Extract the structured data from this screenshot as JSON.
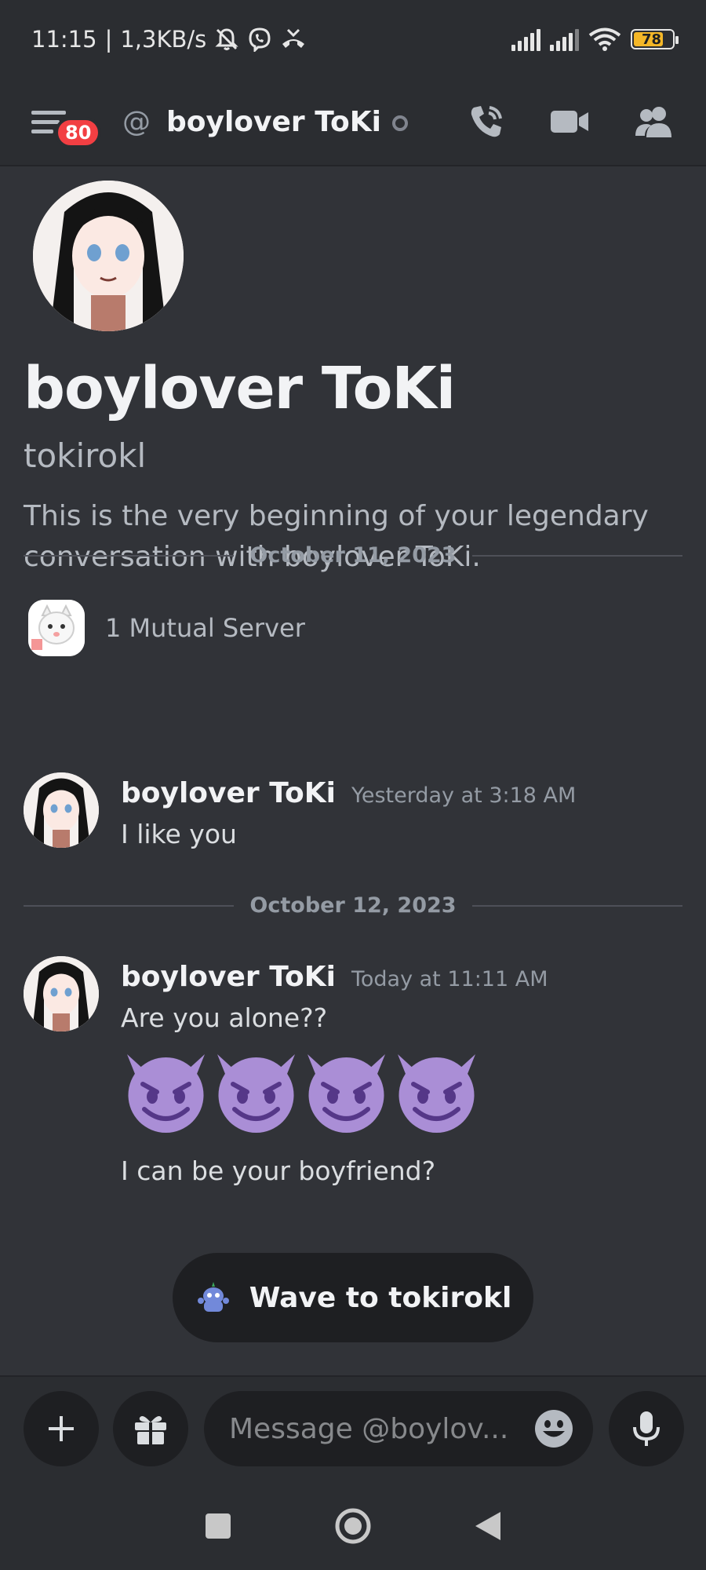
{
  "status_bar": {
    "time": "11:15",
    "net_speed": "1,3KB/s",
    "battery": "78",
    "battery_level": 0.78
  },
  "header": {
    "unread_badge": "80",
    "at_symbol": "@",
    "title": "boylover ToKi",
    "icons": [
      "menu-icon",
      "phone-call-icon",
      "video-camera-icon",
      "members-icon"
    ]
  },
  "profile": {
    "display_name": "boylover ToKi",
    "username": "tokirokl",
    "intro": "This is the very beginning of your legendary conversation with boylover ToKi.",
    "mutual_servers": "1 Mutual Server"
  },
  "messages": [
    {
      "date_divider": "October 11, 2023",
      "author": "boylover ToKi",
      "timestamp": "Yesterday at 3:18 AM",
      "lines": [
        "I like you"
      ]
    },
    {
      "date_divider": "October 12, 2023",
      "author": "boylover ToKi",
      "timestamp": "Today at 11:11 AM",
      "lines": [
        "Are you alone??",
        "I can be your boyfriend?"
      ],
      "emojis": [
        "smiling-imp-emoji",
        "smiling-imp-emoji",
        "smiling-imp-emoji",
        "smiling-imp-emoji"
      ]
    }
  ],
  "wave": {
    "label": "Wave to tokirokl"
  },
  "composer": {
    "placeholder": "Message @boylov..."
  },
  "colors": {
    "background": "#313338",
    "header": "#2b2d31",
    "input": "#1e1f22",
    "badge": "#f23f43",
    "emoji_purple": "#aa8ed6",
    "battery": "#f4b728"
  }
}
